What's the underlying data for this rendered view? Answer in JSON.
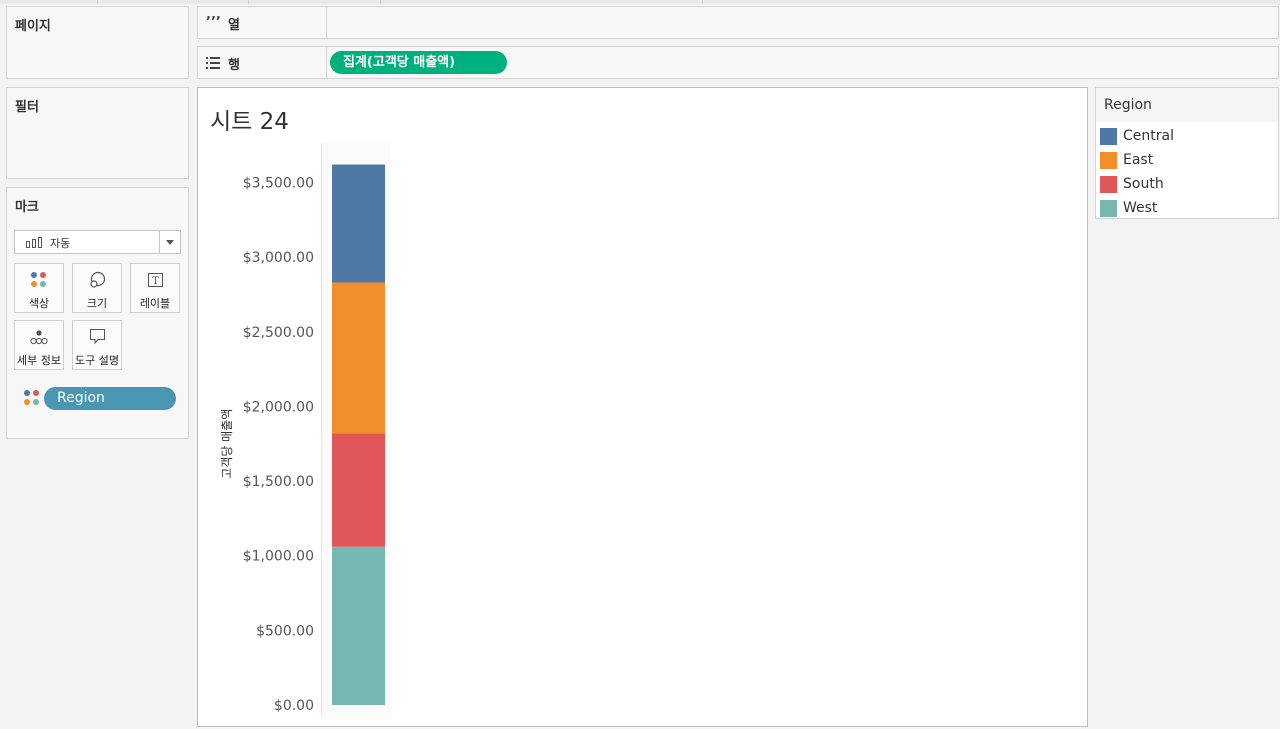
{
  "shelves": {
    "pages_label": "페이지",
    "filters_label": "필터",
    "columns_label": "열",
    "rows_label": "행",
    "rows_pill": "집계(고객당 매출액)"
  },
  "marks": {
    "title": "마크",
    "mark_type": "자동",
    "buttons": {
      "color": "색상",
      "size": "크기",
      "label": "레이블",
      "detail": "세부 정보",
      "tooltip": "도구 설명"
    },
    "color_field_pill": "Region"
  },
  "sheet": {
    "title": "시트 24"
  },
  "legend": {
    "title": "Region",
    "items": [
      {
        "label": "Central",
        "color": "#4e79a7"
      },
      {
        "label": "East",
        "color": "#f28e2b"
      },
      {
        "label": "South",
        "color": "#e15759"
      },
      {
        "label": "West",
        "color": "#76b7b2"
      }
    ]
  },
  "chart_data": {
    "type": "bar",
    "title": "시트 24",
    "xlabel": "",
    "ylabel": "고객당 매출액",
    "categories": [
      ""
    ],
    "stacked": true,
    "series": [
      {
        "name": "West",
        "values": [
          1060
        ],
        "color": "#76b7b2"
      },
      {
        "name": "South",
        "values": [
          760
        ],
        "color": "#e15759"
      },
      {
        "name": "East",
        "values": [
          1010
        ],
        "color": "#f28e2b"
      },
      {
        "name": "Central",
        "values": [
          790
        ],
        "color": "#4e79a7"
      }
    ],
    "y_ticks": [
      "$0.00",
      "$500.00",
      "$1,000.00",
      "$1,500.00",
      "$2,000.00",
      "$2,500.00",
      "$3,000.00",
      "$3,500.00"
    ],
    "ylim": [
      0,
      3500
    ],
    "grid": false,
    "legend_position": "right"
  }
}
